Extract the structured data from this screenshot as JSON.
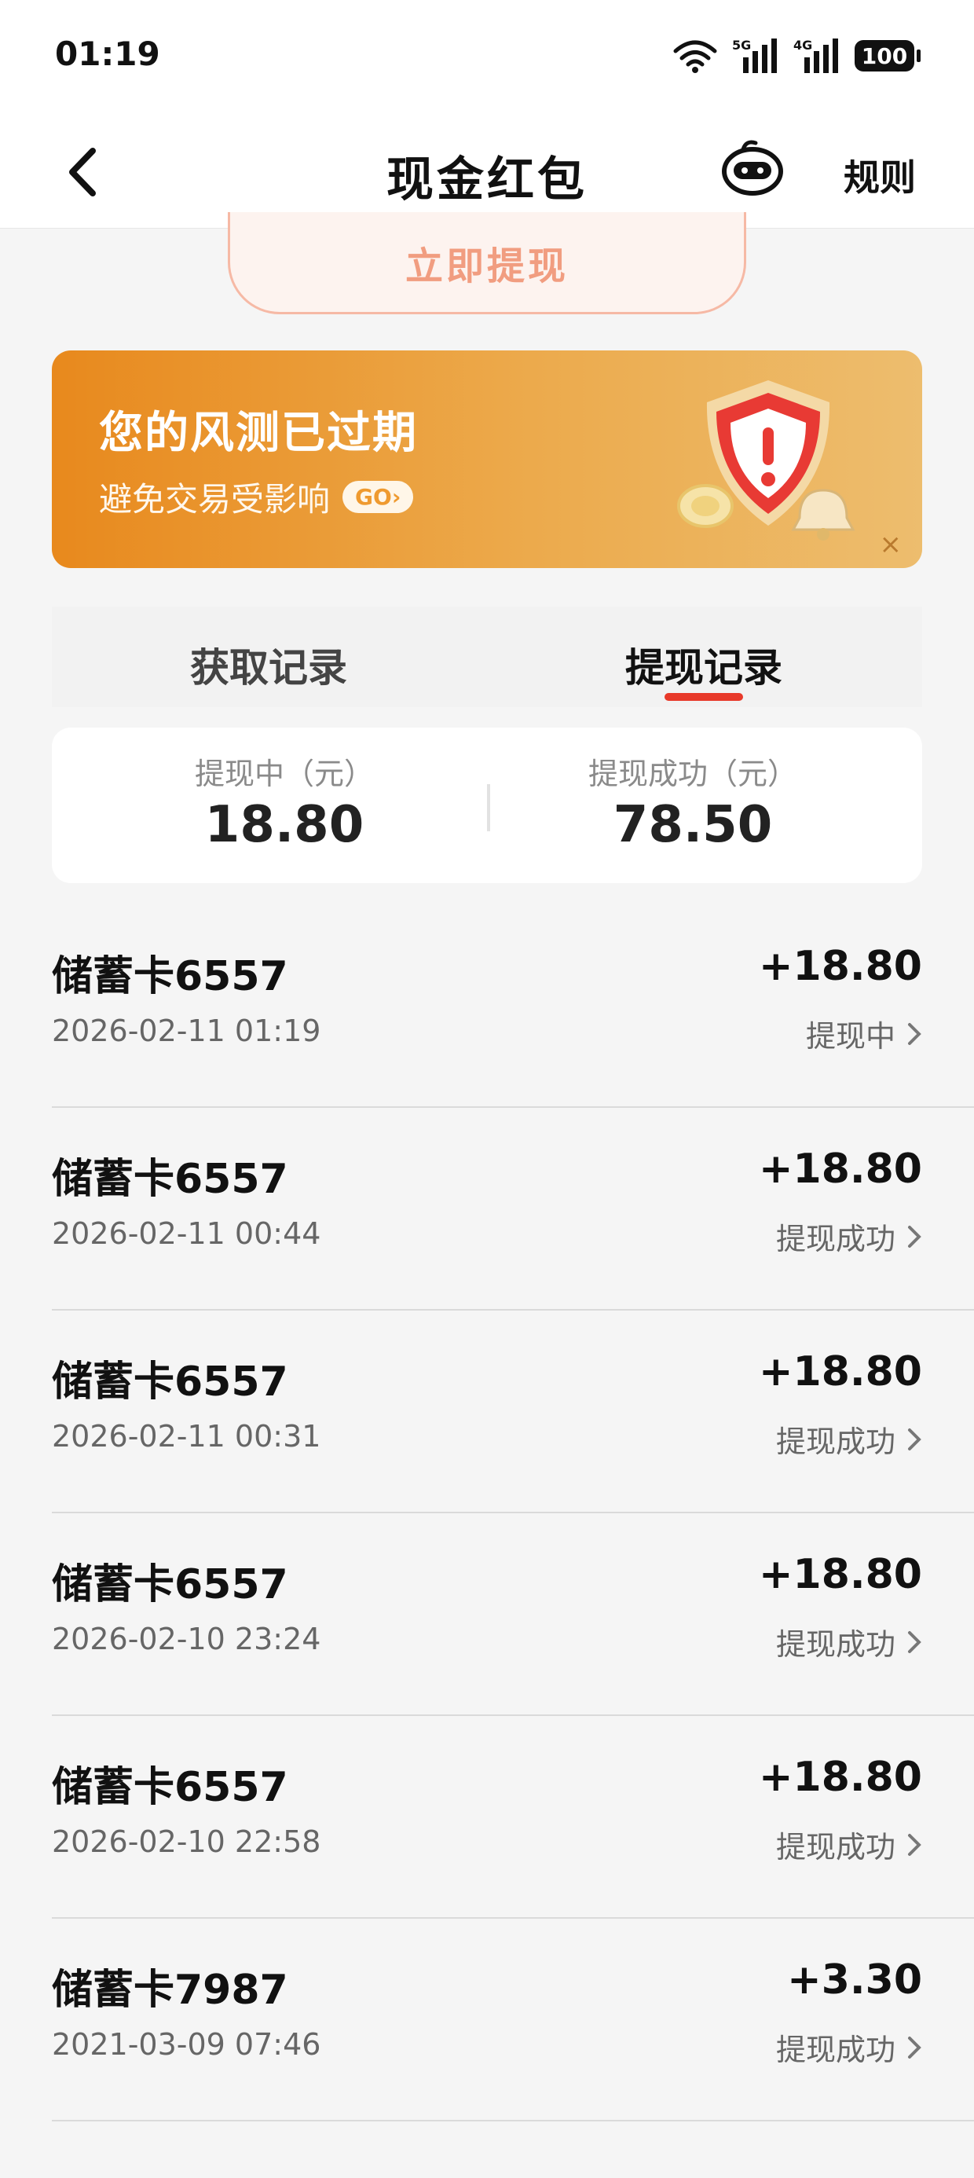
{
  "status_bar": {
    "time": "01:19",
    "network1": "5G",
    "network2": "4G",
    "battery": "100"
  },
  "nav": {
    "title": "现金红包",
    "rules_label": "规则"
  },
  "withdraw_button": "立即提现",
  "banner": {
    "title": "您的风测已过期",
    "subtitle": "避免交易受影响",
    "go_label": "GO",
    "close_symbol": "×"
  },
  "tabs": [
    {
      "label": "获取记录",
      "active": false
    },
    {
      "label": "提现记录",
      "active": true
    }
  ],
  "summary": {
    "pending_label": "提现中（元）",
    "pending_value": "18.80",
    "success_label": "提现成功（元）",
    "success_value": "78.50"
  },
  "records": [
    {
      "title": "储蓄卡6557",
      "time": "2026-02-11 01:19",
      "amount": "+18.80",
      "status": "提现中"
    },
    {
      "title": "储蓄卡6557",
      "time": "2026-02-11 00:44",
      "amount": "+18.80",
      "status": "提现成功"
    },
    {
      "title": "储蓄卡6557",
      "time": "2026-02-11 00:31",
      "amount": "+18.80",
      "status": "提现成功"
    },
    {
      "title": "储蓄卡6557",
      "time": "2026-02-10 23:24",
      "amount": "+18.80",
      "status": "提现成功"
    },
    {
      "title": "储蓄卡6557",
      "time": "2026-02-10 22:58",
      "amount": "+18.80",
      "status": "提现成功"
    },
    {
      "title": "储蓄卡7987",
      "time": "2021-03-09 07:46",
      "amount": "+3.30",
      "status": "提现成功"
    }
  ],
  "colors": {
    "accent_red": "#e8392a",
    "banner_orange": "#e8891d",
    "withdraw_text": "#f19d80"
  }
}
